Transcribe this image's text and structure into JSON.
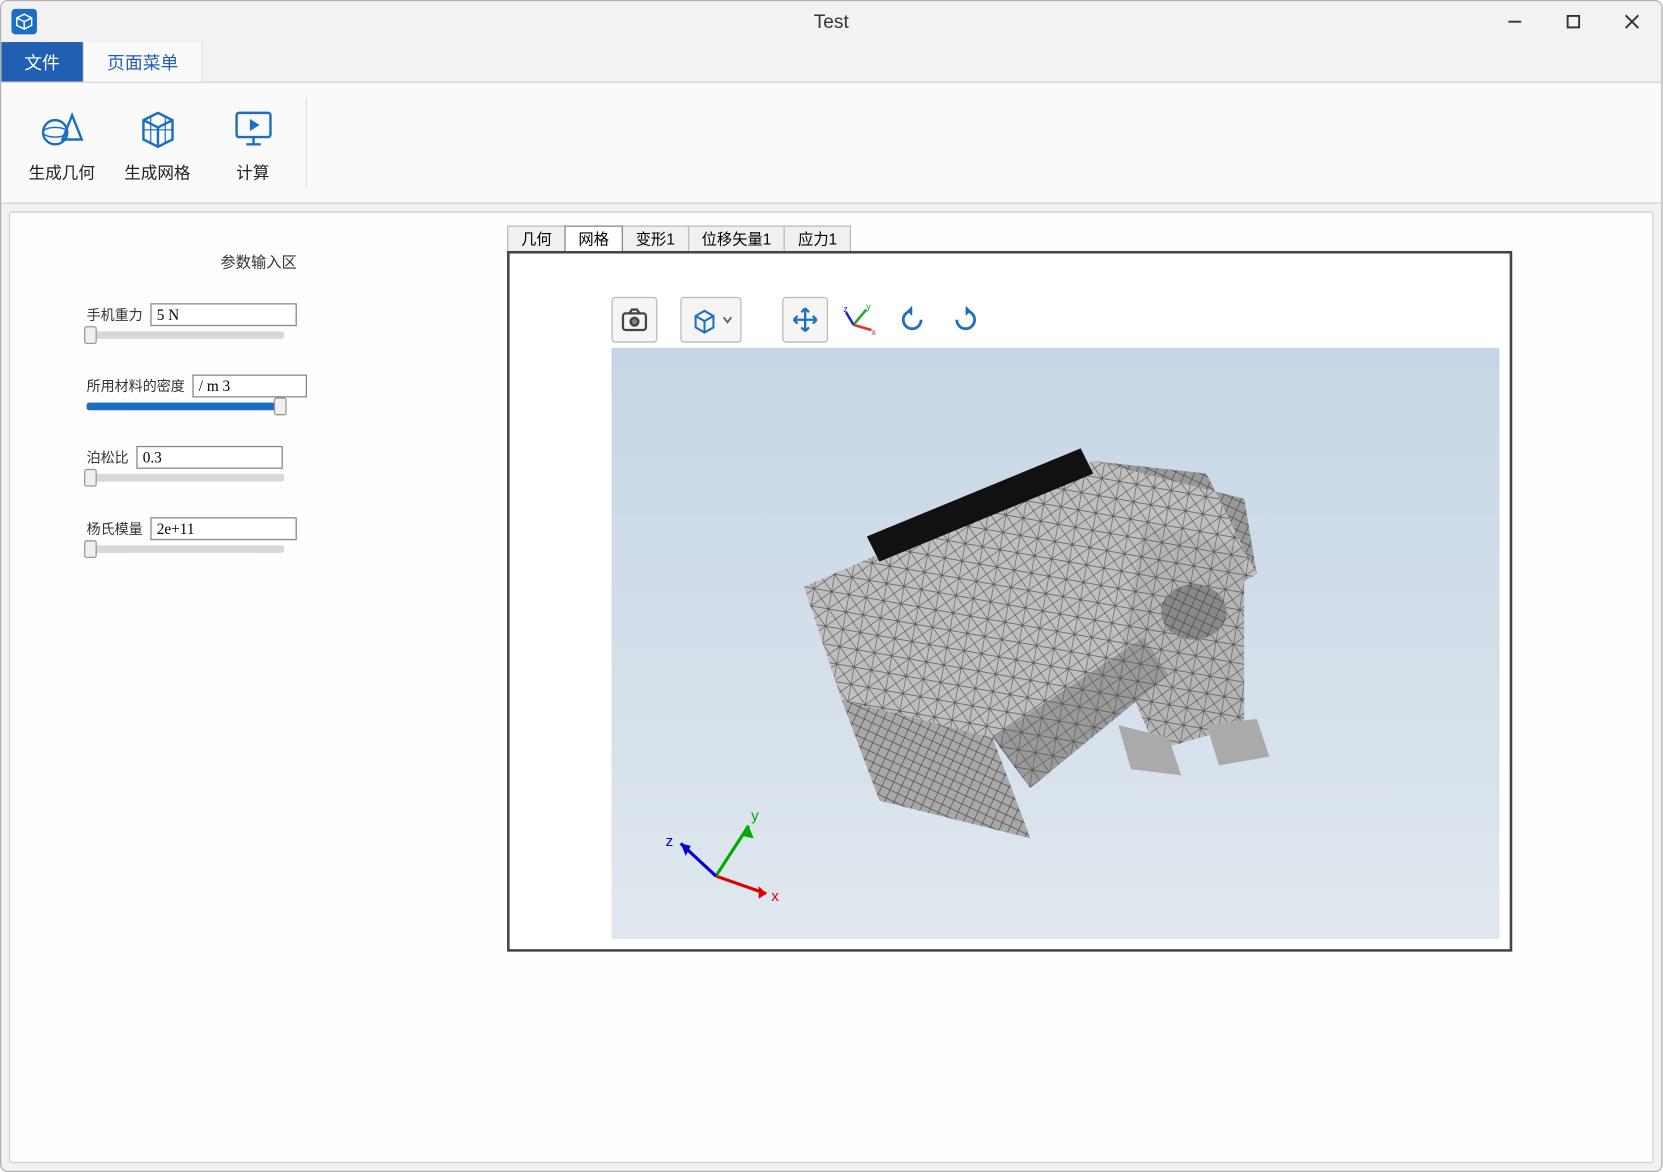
{
  "window": {
    "title": "Test"
  },
  "menu_tabs": [
    {
      "label": "文件",
      "active": true
    },
    {
      "label": "页面菜单",
      "active": false
    }
  ],
  "ribbon": [
    {
      "id": "generate-geometry",
      "label": "生成几何",
      "icon": "sphere-cone"
    },
    {
      "id": "generate-mesh",
      "label": "生成网格",
      "icon": "cube-mesh"
    },
    {
      "id": "compute",
      "label": "计算",
      "icon": "play-monitor"
    }
  ],
  "param_panel": {
    "title": "参数输入区",
    "items": [
      {
        "id": "phone-weight",
        "label": "手机重力",
        "value": "5 N",
        "slider_pct": 2
      },
      {
        "id": "material-density",
        "label": "所用材料的密度",
        "value": "/ m 3",
        "slider_pct": 98
      },
      {
        "id": "poisson-ratio",
        "label": "泊松比",
        "value": "0.3",
        "slider_pct": 2
      },
      {
        "id": "youngs-modulus",
        "label": "杨氏模量",
        "value": "2e+11",
        "slider_pct": 2
      }
    ]
  },
  "viz_tabs": [
    {
      "label": "几何",
      "active": false
    },
    {
      "label": "网格",
      "active": true
    },
    {
      "label": "变形1",
      "active": false
    },
    {
      "label": "位移矢量1",
      "active": false
    },
    {
      "label": "应力1",
      "active": false
    }
  ],
  "toolbar3d": [
    {
      "id": "camera",
      "icon": "camera"
    },
    {
      "id": "view-cube",
      "icon": "view-cube",
      "dropdown": true
    },
    {
      "id": "sep1",
      "sep": true
    },
    {
      "id": "pan",
      "icon": "pan"
    },
    {
      "id": "axes",
      "icon": "axes",
      "noborder": true
    },
    {
      "id": "rotate-left",
      "icon": "rotate-left",
      "noborder": true
    },
    {
      "id": "rotate-right",
      "icon": "rotate-right",
      "noborder": true
    }
  ],
  "axis_triad": {
    "labels": {
      "x": "x",
      "y": "y",
      "z": "z"
    }
  }
}
